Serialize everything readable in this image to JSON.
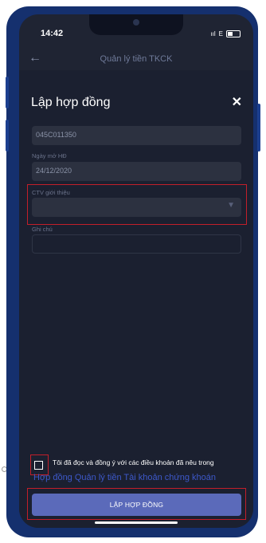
{
  "status_bar": {
    "time": "14:42",
    "signal": "ııl",
    "network": "E"
  },
  "nav": {
    "title": "Quản lý tiền TKCK",
    "back_glyph": "←"
  },
  "modal": {
    "title": "Lập hợp đồng",
    "close_glyph": "✕"
  },
  "form": {
    "account_value": "045C011350",
    "open_date_label": "Ngày mở HĐ",
    "open_date_value": "24/12/2020",
    "referrer_label": "CTV giới thiệu",
    "referrer_value": "",
    "note_label": "Ghi chú",
    "note_value": ""
  },
  "terms": {
    "text": "Tôi đã đọc và đồng ý với các điều khoản đã nêu trong",
    "link": "Hợp đồng Quản lý tiền Tài khoản chứng khoán",
    "checked": false
  },
  "submit_label": "LẬP HỢP ĐỒNG",
  "colors": {
    "background": "#1f2433",
    "field": "#2c3140",
    "button": "#5b6aba",
    "link": "#3d58c9",
    "highlight": "#c21f2a"
  }
}
